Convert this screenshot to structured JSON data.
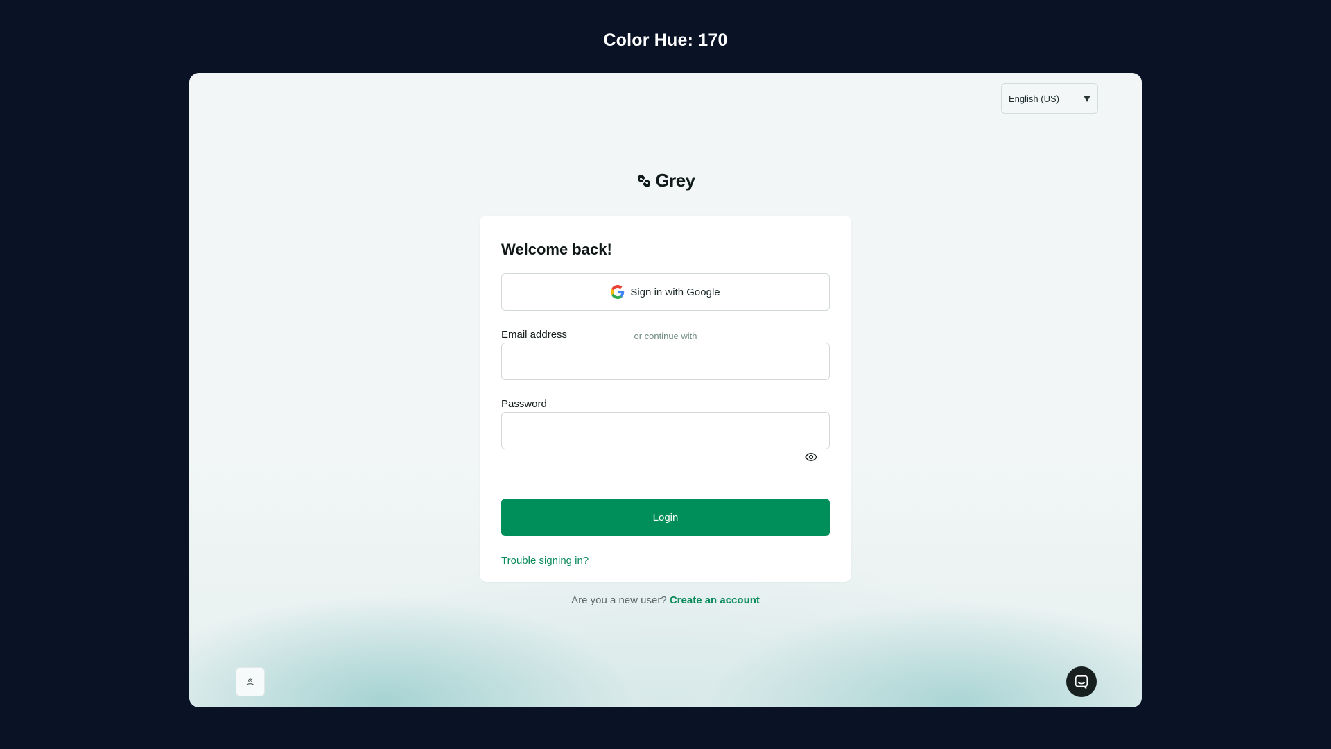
{
  "caption": "Color Hue: 170",
  "language_select": {
    "value": "English (US)"
  },
  "brand": {
    "name": "Grey"
  },
  "login_card": {
    "title": "Welcome back!",
    "google_button_label": "Sign in with Google",
    "divider_text": "or continue with",
    "email_label": "Email address",
    "email_value": "",
    "password_label": "Password",
    "password_value": "",
    "login_button_label": "Login",
    "trouble_link": "Trouble signing in?"
  },
  "signup": {
    "prompt": "Are you a new user?",
    "link": "Create an account"
  },
  "colors": {
    "background": "#0a1226",
    "primary": "#008f5a",
    "link": "#0b8a5a",
    "frame": "#f2f6f6"
  },
  "icons": {
    "google": "google-g-icon",
    "password_toggle": "eye-icon",
    "dropdown": "caret-down-icon",
    "corner": "user-profile-icon",
    "chat": "chat-bubble-icon"
  }
}
